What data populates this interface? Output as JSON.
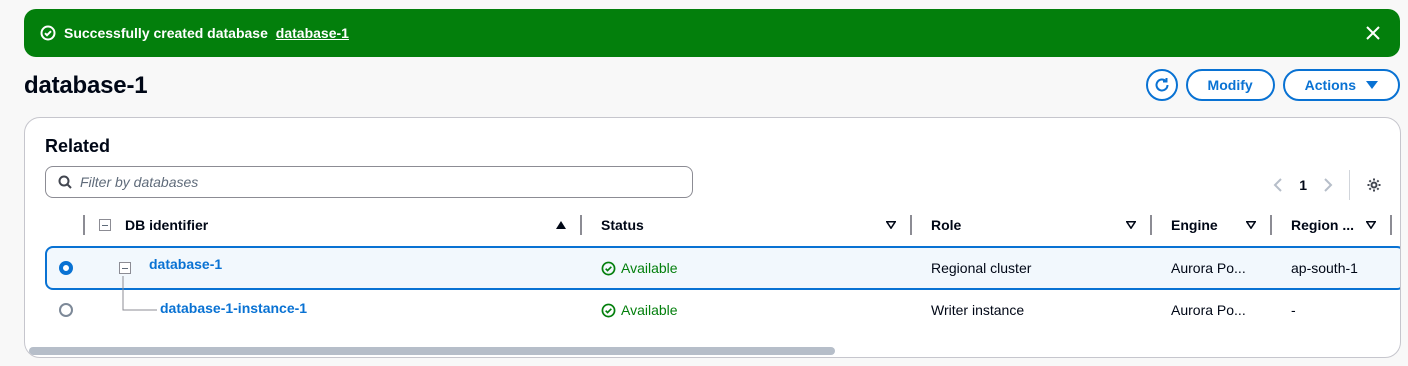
{
  "flash": {
    "message": "Successfully created database",
    "link": "database-1",
    "bg_color": "#037f0c"
  },
  "header": {
    "title": "database-1",
    "refresh_icon": "refresh-icon",
    "modify_label": "Modify",
    "actions_label": "Actions"
  },
  "related": {
    "title": "Related",
    "search_placeholder": "Filter by databases",
    "page": "1",
    "columns": [
      "DB identifier",
      "Status",
      "Role",
      "Engine",
      "Region ..."
    ],
    "rows": [
      {
        "id": "database-1",
        "status": "Available",
        "role": "Regional cluster",
        "engine": "Aurora Po...",
        "region": "ap-south-1",
        "selected": true
      },
      {
        "id": "database-1-instance-1",
        "status": "Available",
        "role": "Writer instance",
        "engine": "Aurora Po...",
        "region": "-",
        "selected": false
      }
    ]
  },
  "colors": {
    "accent": "#0972d3",
    "success": "#037f0c"
  }
}
